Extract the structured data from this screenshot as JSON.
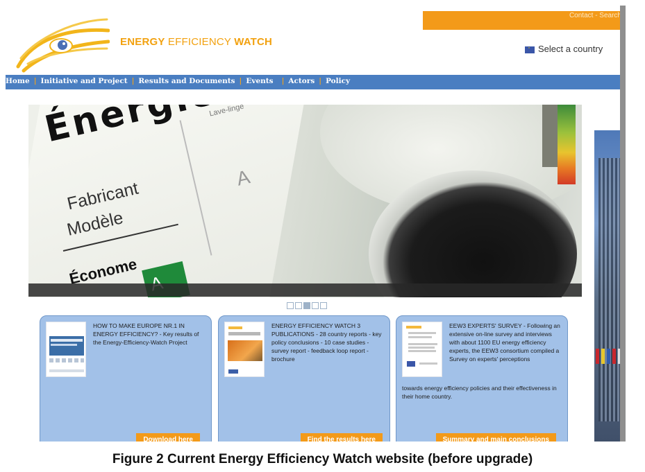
{
  "header": {
    "brand_part1": "ENERGY",
    "brand_part2": " EFFICIENCY ",
    "brand_part3": "WATCH",
    "top_links": "Contact - Search",
    "country_selector": "Select a country"
  },
  "nav": {
    "items": [
      "Home",
      "Initiative and Project",
      "Results and Documents",
      "Events",
      "Actors",
      "Policy"
    ],
    "separator": "|"
  },
  "hero": {
    "label_word": "Énergie",
    "label_sub": "Lave-linge",
    "label_fabricant": "Fabricant",
    "label_modele": "Modèle",
    "label_econome": "Économe",
    "label_class": "A",
    "slider_count": 5,
    "slider_active": 3
  },
  "boxes": [
    {
      "text": "HOW TO MAKE EUROPE NR.1 IN ENERGY EFFICIENCY? - Key results of the Energy-Efficiency-Watch Project",
      "button": "Download here"
    },
    {
      "text": "ENERGY EFFICIENCY WATCH 3 PUBLICATIONS - 28 country reports - key policy conclusions - 10 case studies - survey report - feedback loop report - brochure",
      "button": "Find the results here"
    },
    {
      "text_top": "EEW3 EXPERTS' SURVEY - Following an extensive on-line survey and interviews with about 1100 EU energy efficiency experts, the EEW3 consortium compiled a Survey on experts' perceptions",
      "text_bottom": "towards energy efficiency policies and their effectiveness in their home country.",
      "button": "Summary and main conclusions"
    }
  ],
  "caption": "Figure 2 Current Energy Efficiency Watch website (before upgrade)",
  "colors": {
    "accent_orange": "#f39a19",
    "nav_blue": "#4a7ec1",
    "box_blue": "#a2c1e8"
  },
  "icons": [
    "logo-swoosh-icon",
    "eu-flag-icon"
  ]
}
